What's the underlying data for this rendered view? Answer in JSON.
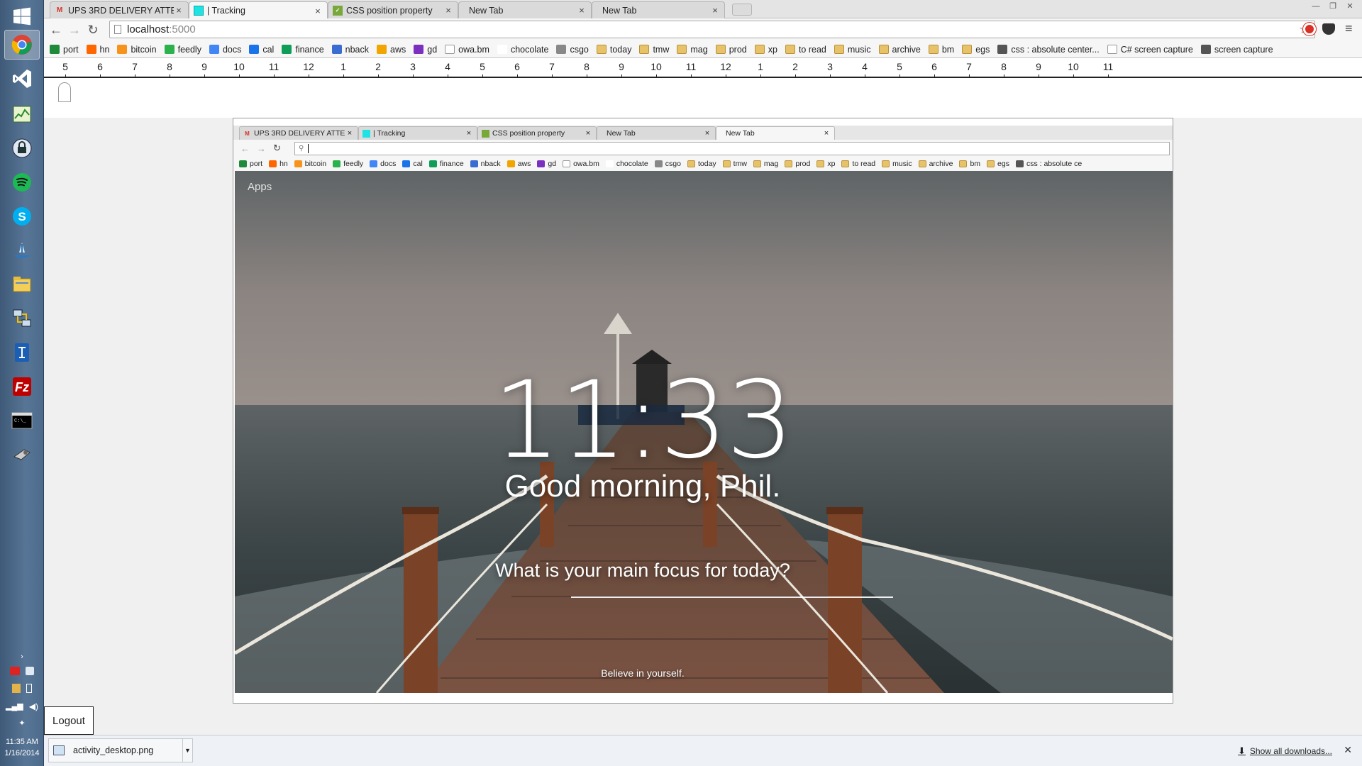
{
  "taskbar": {
    "apps": [
      "chrome-icon",
      "visual-studio-icon",
      "task-manager-icon",
      "keepass-icon",
      "spotify-icon",
      "skype-icon",
      "flight-icon",
      "file-explorer-icon",
      "network-icon",
      "tortoise-icon",
      "filezilla-icon",
      "command-prompt-icon",
      "settings-icon"
    ],
    "clock_time": "11:35 AM",
    "clock_date": "1/16/2014"
  },
  "browser": {
    "tabs": [
      {
        "label": "UPS 3RD DELIVERY ATTEM",
        "icon": "gmail-icon"
      },
      {
        "label": "| Tracking",
        "icon": "tracking-icon"
      },
      {
        "label": "CSS position property",
        "icon": "css-icon"
      },
      {
        "label": "New Tab",
        "icon": ""
      },
      {
        "label": "New Tab",
        "icon": ""
      }
    ],
    "url_host": "localhost",
    "url_path": ":5000",
    "bookmarks": [
      "port",
      "hn",
      "bitcoin",
      "feedly",
      "docs",
      "cal",
      "finance",
      "nback",
      "aws",
      "gd",
      "owa.bm",
      "chocolate",
      "csgo",
      "today",
      "tmw",
      "mag",
      "prod",
      "xp",
      "to read",
      "music",
      "archive",
      "bm",
      "egs",
      "css : absolute center...",
      "C# screen capture",
      "screen capture"
    ]
  },
  "ruler": {
    "labels": [
      "5",
      "6",
      "7",
      "8",
      "9",
      "10",
      "11",
      "12",
      "1",
      "2",
      "3",
      "4",
      "5",
      "6",
      "7",
      "8",
      "9",
      "10",
      "11",
      "12",
      "1",
      "2",
      "3",
      "4",
      "5",
      "6",
      "7",
      "8",
      "9",
      "10",
      "11"
    ]
  },
  "screenshot": {
    "tabs": [
      {
        "label": "UPS 3RD DELIVERY ATTEM"
      },
      {
        "label": "| Tracking"
      },
      {
        "label": "CSS position property"
      },
      {
        "label": "New Tab"
      },
      {
        "label": "New Tab"
      }
    ],
    "bookmarks": [
      "port",
      "hn",
      "bitcoin",
      "feedly",
      "docs",
      "cal",
      "finance",
      "nback",
      "aws",
      "gd",
      "owa.bm",
      "chocolate",
      "csgo",
      "today",
      "tmw",
      "mag",
      "prod",
      "xp",
      "to read",
      "music",
      "archive",
      "bm",
      "egs",
      "css : absolute ce"
    ],
    "apps_label": "Apps",
    "clock": "11:33",
    "greeting": "Good morning, Phil.",
    "focus_question": "What is your main focus for today?",
    "quote": "Believe in yourself."
  },
  "logout_label": "Logout",
  "downloads": {
    "file": "activity_desktop.png",
    "show_all": "Show all downloads..."
  },
  "colors": {
    "taskbar": "#4d6a8b",
    "accent_red": "#d93025"
  }
}
